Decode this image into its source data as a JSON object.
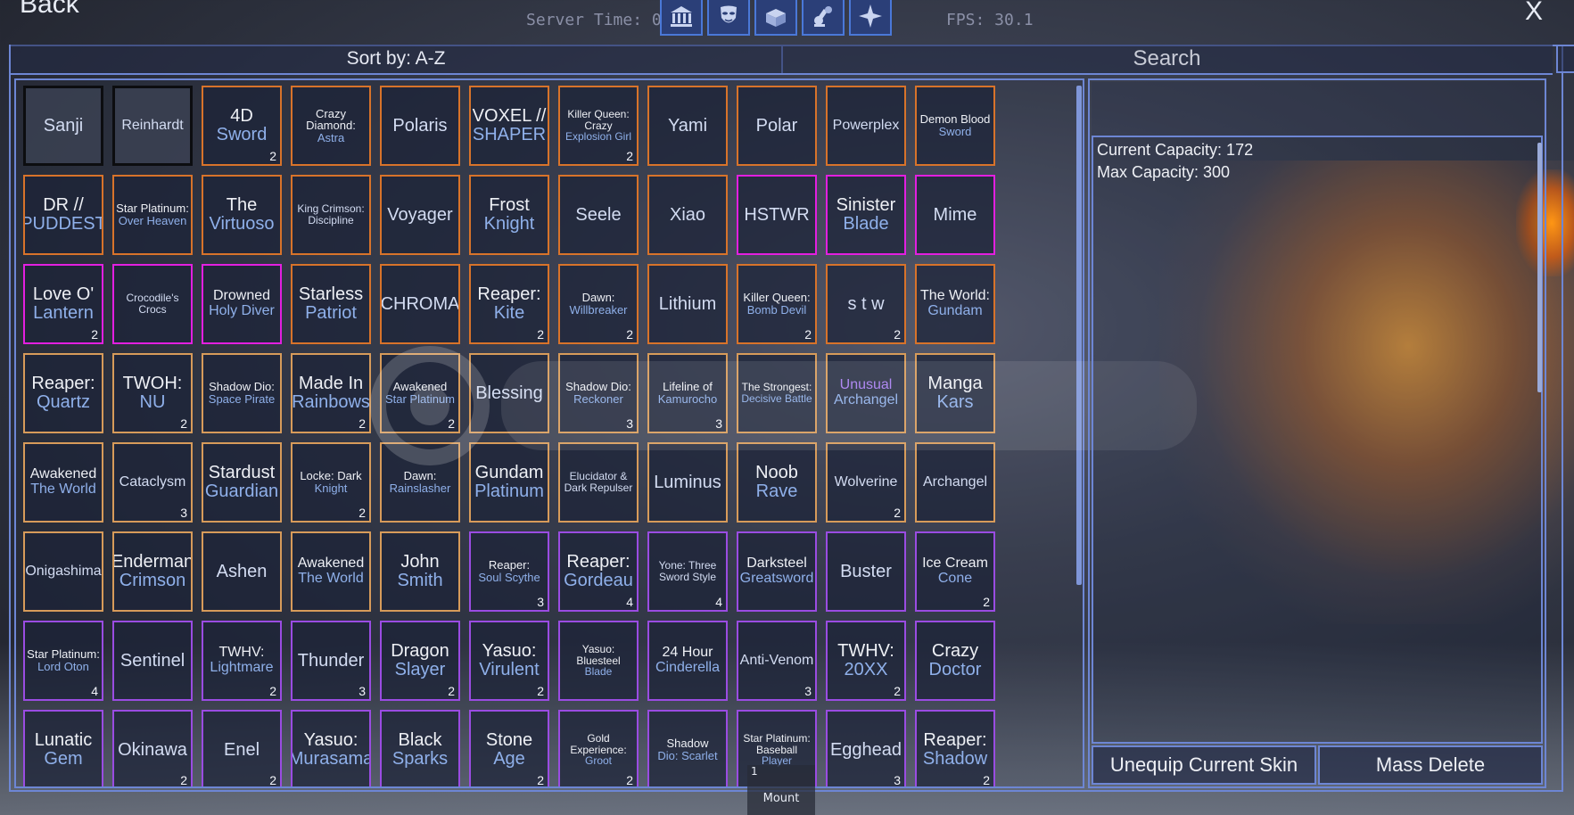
{
  "topbar": {
    "back_label": "Back",
    "server_time": "Server Time: 0",
    "fps": "FPS: 30.1",
    "close_label": "X",
    "icons": [
      "bank-icon",
      "mask-icon",
      "chest-icon",
      "robot-arm-icon",
      "sparkle-icon"
    ]
  },
  "toolbar": {
    "sort_label": "Sort by: A-Z",
    "search_label": "Search"
  },
  "skins": [
    {
      "l1": "Sanji",
      "l2": "",
      "count": "",
      "border": "black"
    },
    {
      "l1": "Reinhardt",
      "l2": "",
      "count": "",
      "border": "black"
    },
    {
      "l1": "4D",
      "l2": "Sword",
      "count": "2",
      "border": "orange"
    },
    {
      "l1": "Crazy Diamond:",
      "l2": "Astra",
      "count": "",
      "border": "orange"
    },
    {
      "l1": "Polaris",
      "l2": "",
      "count": "",
      "border": "orange"
    },
    {
      "l1": "VOXEL //",
      "l2": "SHAPER",
      "count": "",
      "border": "orange"
    },
    {
      "l1": "Killer Queen: Crazy",
      "l2": "Explosion Girl",
      "count": "2",
      "border": "orange"
    },
    {
      "l1": "Yami",
      "l2": "",
      "count": "",
      "border": "orange"
    },
    {
      "l1": "Polar",
      "l2": "",
      "count": "",
      "border": "orange"
    },
    {
      "l1": "Powerplex",
      "l2": "",
      "count": "",
      "border": "orange"
    },
    {
      "l1": "Demon Blood",
      "l2": "Sword",
      "count": "",
      "border": "orange"
    },
    {
      "l1": "DR //",
      "l2": "PUDDEST",
      "count": "",
      "border": "orange"
    },
    {
      "l1": "Star Platinum:",
      "l2": "Over Heaven",
      "count": "",
      "border": "orange"
    },
    {
      "l1": "The",
      "l2": "Virtuoso",
      "count": "",
      "border": "orange"
    },
    {
      "l1": "King Crimson: Discipline",
      "l2": "",
      "count": "",
      "border": "orange"
    },
    {
      "l1": "Voyager",
      "l2": "",
      "count": "",
      "border": "orange"
    },
    {
      "l1": "Frost",
      "l2": "Knight",
      "count": "",
      "border": "orange"
    },
    {
      "l1": "Seele",
      "l2": "",
      "count": "",
      "border": "orange"
    },
    {
      "l1": "Xiao",
      "l2": "",
      "count": "",
      "border": "orange"
    },
    {
      "l1": "HSTWR",
      "l2": "",
      "count": "",
      "border": "pink"
    },
    {
      "l1": "Sinister",
      "l2": "Blade",
      "count": "",
      "border": "pink"
    },
    {
      "l1": "Mime",
      "l2": "",
      "count": "",
      "border": "pink"
    },
    {
      "l1": "Love O'",
      "l2": "Lantern",
      "count": "2",
      "border": "pink"
    },
    {
      "l1": "Crocodile's Crocs",
      "l2": "",
      "count": "",
      "border": "pink"
    },
    {
      "l1": "Drowned",
      "l2": "Holy Diver",
      "count": "",
      "border": "pink"
    },
    {
      "l1": "Starless",
      "l2": "Patriot",
      "count": "",
      "border": "orange"
    },
    {
      "l1": "CHROMA",
      "l2": "",
      "count": "",
      "border": "orange"
    },
    {
      "l1": "Reaper:",
      "l2": "Kite",
      "count": "2",
      "border": "orange"
    },
    {
      "l1": "Dawn:",
      "l2": "Willbreaker",
      "count": "2",
      "border": "orange"
    },
    {
      "l1": "Lithium",
      "l2": "",
      "count": "",
      "border": "orange"
    },
    {
      "l1": "Killer Queen:",
      "l2": "Bomb Devil",
      "count": "2",
      "border": "orange"
    },
    {
      "l1": "s t w",
      "l2": "",
      "count": "2",
      "border": "orange"
    },
    {
      "l1": "The World:",
      "l2": "Gundam",
      "count": "",
      "border": "orange"
    },
    {
      "l1": "Reaper:",
      "l2": "Quartz",
      "count": "",
      "border": "tan"
    },
    {
      "l1": "TWOH:",
      "l2": "NU",
      "count": "2",
      "border": "tan"
    },
    {
      "l1": "Shadow Dio:",
      "l2": "Space Pirate",
      "count": "",
      "border": "tan"
    },
    {
      "l1": "Made In",
      "l2": "Rainbows",
      "count": "2",
      "border": "tan"
    },
    {
      "l1": "Awakened",
      "l2": "Star Platinum",
      "count": "2",
      "border": "tan"
    },
    {
      "l1": "Blessing",
      "l2": "",
      "count": "",
      "border": "tan"
    },
    {
      "l1": "Shadow Dio:",
      "l2": "Reckoner",
      "count": "3",
      "border": "tan"
    },
    {
      "l1": "Lifeline of",
      "l2": "Kamurocho",
      "count": "3",
      "border": "tan"
    },
    {
      "l1": "The Strongest:",
      "l2": "Decisive Battle",
      "count": "",
      "border": "tan"
    },
    {
      "l1": "Unusual",
      "l2": "Archangel",
      "count": "",
      "border": "tan",
      "purple": true
    },
    {
      "l1": "Manga",
      "l2": "Kars",
      "count": "",
      "border": "tan"
    },
    {
      "l1": "Awakened",
      "l2": "The World",
      "count": "",
      "border": "tan"
    },
    {
      "l1": "Cataclysm",
      "l2": "",
      "count": "3",
      "border": "tan"
    },
    {
      "l1": "Stardust",
      "l2": "Guardian",
      "count": "",
      "border": "tan"
    },
    {
      "l1": "Locke: Dark",
      "l2": "Knight",
      "count": "2",
      "border": "tan"
    },
    {
      "l1": "Dawn:",
      "l2": "Rainslasher",
      "count": "",
      "border": "tan"
    },
    {
      "l1": "Gundam",
      "l2": "Platinum",
      "count": "",
      "border": "tan"
    },
    {
      "l1": "Elucidator & Dark Repulser",
      "l2": "",
      "count": "",
      "border": "tan"
    },
    {
      "l1": "Luminus",
      "l2": "",
      "count": "",
      "border": "tan"
    },
    {
      "l1": "Noob",
      "l2": "Rave",
      "count": "",
      "border": "tan"
    },
    {
      "l1": "Wolverine",
      "l2": "",
      "count": "2",
      "border": "tan"
    },
    {
      "l1": "Archangel",
      "l2": "",
      "count": "",
      "border": "tan"
    },
    {
      "l1": "Onigashima",
      "l2": "",
      "count": "",
      "border": "tan"
    },
    {
      "l1": "Enderman",
      "l2": "Crimson",
      "count": "",
      "border": "tan"
    },
    {
      "l1": "Ashen",
      "l2": "",
      "count": "",
      "border": "tan"
    },
    {
      "l1": "Awakened",
      "l2": "The World",
      "count": "",
      "border": "tan"
    },
    {
      "l1": "John",
      "l2": "Smith",
      "count": "",
      "border": "tan"
    },
    {
      "l1": "Reaper:",
      "l2": "Soul Scythe",
      "count": "3",
      "border": "purple"
    },
    {
      "l1": "Reaper:",
      "l2": "Gordeau",
      "count": "4",
      "border": "purple"
    },
    {
      "l1": "Yone: Three Sword Style",
      "l2": "",
      "count": "4",
      "border": "purple"
    },
    {
      "l1": "Darksteel",
      "l2": "Greatsword",
      "count": "",
      "border": "purple"
    },
    {
      "l1": "Buster",
      "l2": "",
      "count": "",
      "border": "purple"
    },
    {
      "l1": "Ice Cream",
      "l2": "Cone",
      "count": "2",
      "border": "purple"
    },
    {
      "l1": "Star Platinum:",
      "l2": "Lord Oton",
      "count": "4",
      "border": "purple"
    },
    {
      "l1": "Sentinel",
      "l2": "",
      "count": "",
      "border": "purple"
    },
    {
      "l1": "TWHV:",
      "l2": "Lightmare",
      "count": "2",
      "border": "purple"
    },
    {
      "l1": "Thunder",
      "l2": "",
      "count": "3",
      "border": "purple"
    },
    {
      "l1": "Dragon",
      "l2": "Slayer",
      "count": "2",
      "border": "purple"
    },
    {
      "l1": "Yasuo:",
      "l2": "Virulent",
      "count": "2",
      "border": "purple"
    },
    {
      "l1": "Yasuo: Bluesteel",
      "l2": "Blade",
      "count": "",
      "border": "purple"
    },
    {
      "l1": "24 Hour",
      "l2": "Cinderella",
      "count": "",
      "border": "purple"
    },
    {
      "l1": "Anti-Venom",
      "l2": "",
      "count": "3",
      "border": "purple"
    },
    {
      "l1": "TWHV:",
      "l2": "20XX",
      "count": "2",
      "border": "purple"
    },
    {
      "l1": "Crazy",
      "l2": "Doctor",
      "count": "",
      "border": "purple"
    },
    {
      "l1": "Lunatic",
      "l2": "Gem",
      "count": "",
      "border": "purple"
    },
    {
      "l1": "Okinawa",
      "l2": "",
      "count": "2",
      "border": "purple"
    },
    {
      "l1": "Enel",
      "l2": "",
      "count": "2",
      "border": "purple"
    },
    {
      "l1": "Yasuo:",
      "l2": "Murasama",
      "count": "",
      "border": "purple"
    },
    {
      "l1": "Black",
      "l2": "Sparks",
      "count": "",
      "border": "purple"
    },
    {
      "l1": "Stone",
      "l2": "Age",
      "count": "2",
      "border": "purple"
    },
    {
      "l1": "Gold Experience:",
      "l2": "Groot",
      "count": "2",
      "border": "purple"
    },
    {
      "l1": "Shadow",
      "l2": "Dio: Scarlet",
      "count": "",
      "border": "purple"
    },
    {
      "l1": "Star Platinum: Baseball",
      "l2": "Player",
      "count": "",
      "border": "purple"
    },
    {
      "l1": "Egghead",
      "l2": "",
      "count": "3",
      "border": "purple"
    },
    {
      "l1": "Reaper:",
      "l2": "Shadow",
      "count": "2",
      "border": "purple"
    }
  ],
  "capacity": {
    "current": "Current Capacity: 172",
    "max": "Max Capacity: 300"
  },
  "buttons": {
    "unequip": "Unequip Current Skin",
    "mass_delete": "Mass Delete"
  },
  "hotbar": {
    "slot_number": "1",
    "slot_label": "Mount"
  },
  "colors": {
    "orange": "#d8732a",
    "tan": "#d79b5a",
    "pink": "#e31fe0",
    "purple": "#9a4ce2",
    "black": "#0c0d10",
    "accent": "#6d86d4"
  }
}
